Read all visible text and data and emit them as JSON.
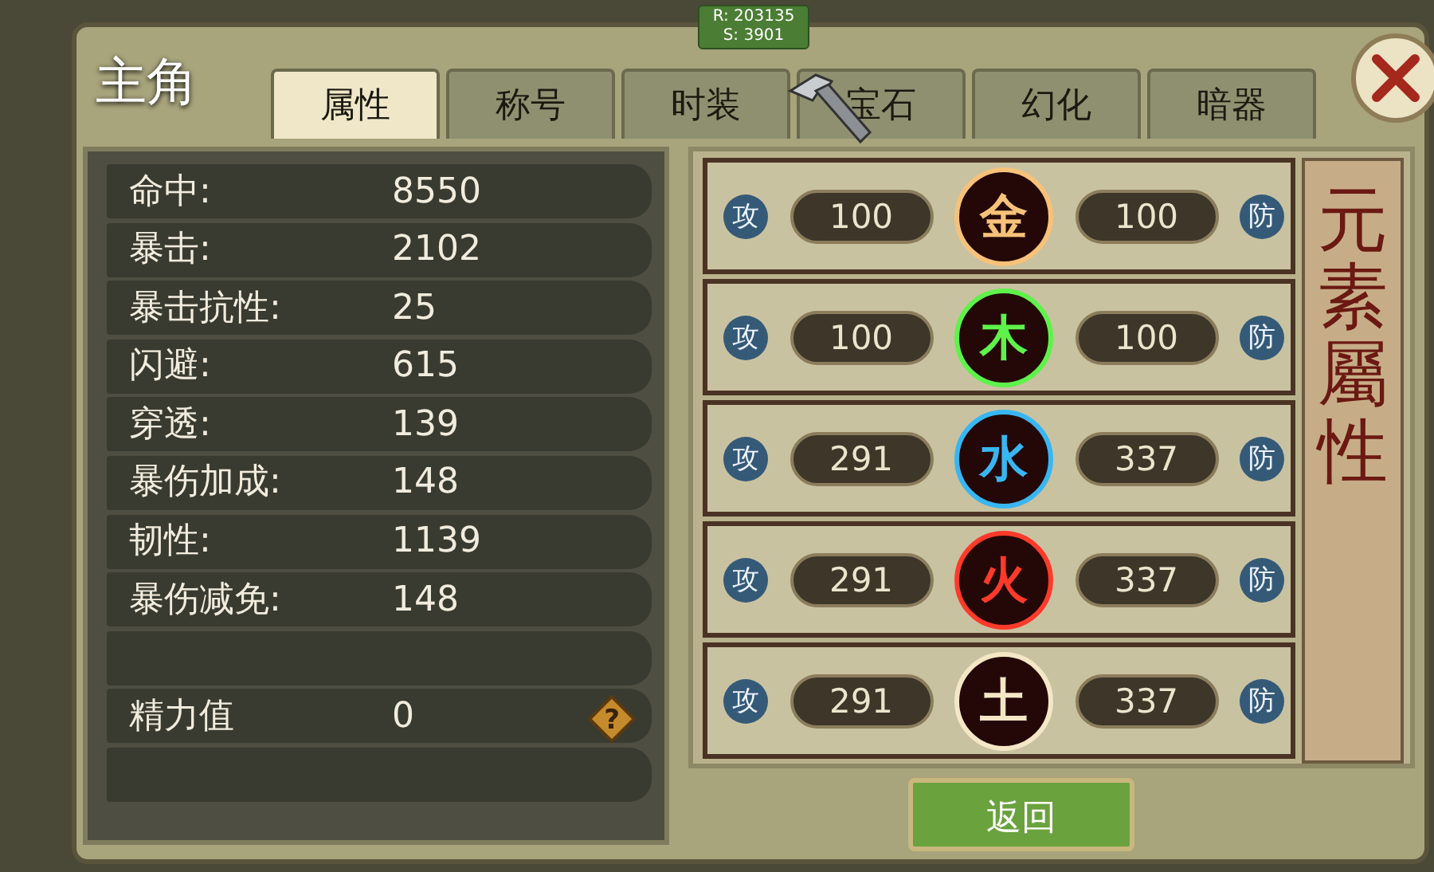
{
  "title": "主角",
  "badge": {
    "lines": [
      "R: 203135",
      "S: 3901"
    ]
  },
  "tabs": [
    {
      "label": "属性",
      "selected": true
    },
    {
      "label": "称号",
      "selected": false
    },
    {
      "label": "时装",
      "selected": false
    },
    {
      "label": "宝石",
      "selected": false
    },
    {
      "label": "幻化",
      "selected": false
    },
    {
      "label": "暗器",
      "selected": false
    }
  ],
  "stats": [
    {
      "kind": "stat",
      "label": "命中:",
      "value": "8550"
    },
    {
      "kind": "stat",
      "label": "暴击:",
      "value": "2102"
    },
    {
      "kind": "stat",
      "label": "暴击抗性:",
      "value": "25"
    },
    {
      "kind": "stat",
      "label": "闪避:",
      "value": "615"
    },
    {
      "kind": "stat",
      "label": "穿透:",
      "value": "139"
    },
    {
      "kind": "stat",
      "label": "暴伤加成:",
      "value": "148"
    },
    {
      "kind": "stat",
      "label": "韧性:",
      "value": "1139"
    },
    {
      "kind": "stat",
      "label": "暴伤减免:",
      "value": "148"
    },
    {
      "kind": "blank"
    },
    {
      "kind": "help",
      "label": "精力值",
      "value": "0",
      "help": "?"
    },
    {
      "kind": "blank"
    }
  ],
  "elements": [
    {
      "attack_label": "攻",
      "attack": "100",
      "element": "金",
      "color": "#f6c27a",
      "defense": "100",
      "defense_label": "防"
    },
    {
      "attack_label": "攻",
      "attack": "100",
      "element": "木",
      "color": "#5ef24a",
      "defense": "100",
      "defense_label": "防"
    },
    {
      "attack_label": "攻",
      "attack": "291",
      "element": "水",
      "color": "#38b6f2",
      "defense": "337",
      "defense_label": "防"
    },
    {
      "attack_label": "攻",
      "attack": "291",
      "element": "火",
      "color": "#ff3a2a",
      "defense": "337",
      "defense_label": "防"
    },
    {
      "attack_label": "攻",
      "attack": "291",
      "element": "土",
      "color": "#f4e7c6",
      "defense": "337",
      "defense_label": "防"
    }
  ],
  "scroll_title": "元素屬性",
  "back_button": "返回"
}
